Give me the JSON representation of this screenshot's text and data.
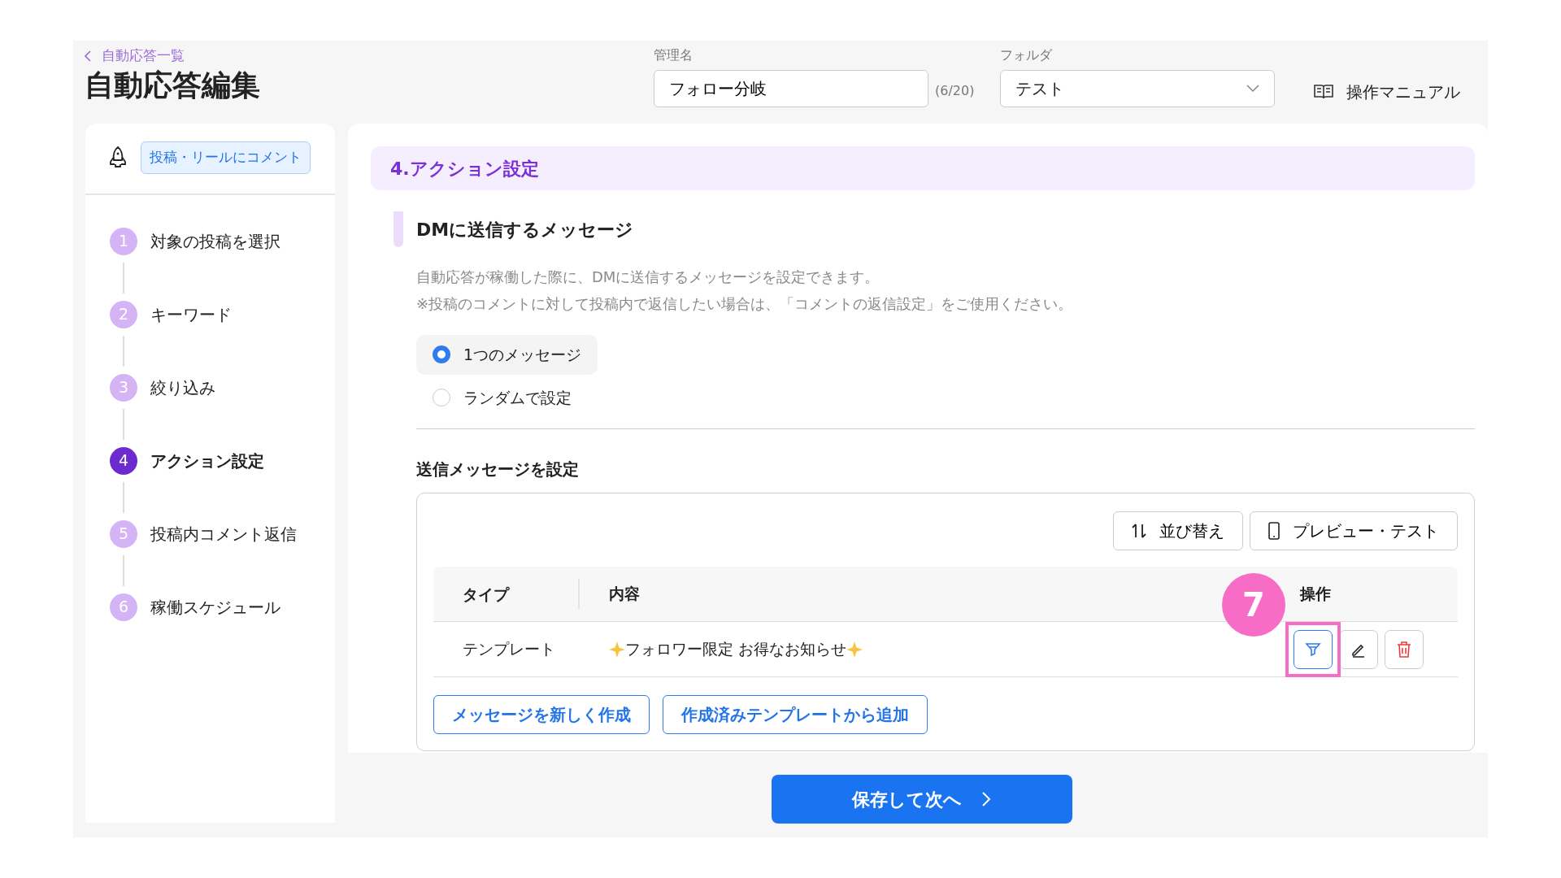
{
  "breadcrumb": "自動応答一覧",
  "title": "自動応答編集",
  "name_field": {
    "label": "管理名",
    "value": "フォロー分岐",
    "counter": "(6/20)"
  },
  "folder_field": {
    "label": "フォルダ",
    "value": "テスト"
  },
  "manual_link": "操作マニュアル",
  "trigger_tag": "投稿・リールにコメント",
  "steps": [
    {
      "number": "1",
      "label": "対象の投稿を選択",
      "selected": false
    },
    {
      "number": "2",
      "label": "キーワード",
      "selected": false
    },
    {
      "number": "3",
      "label": "絞り込み",
      "selected": false
    },
    {
      "number": "4",
      "label": "アクション設定",
      "selected": true
    },
    {
      "number": "5",
      "label": "投稿内コメント返信",
      "selected": false
    },
    {
      "number": "6",
      "label": "稼働スケジュール",
      "selected": false
    }
  ],
  "section_title": "4.アクション設定",
  "subtitle": "DMに送信するメッセージ",
  "description": [
    "自動応答が稼働した際に、DMに送信するメッセージを設定できます。",
    "※投稿のコメントに対して投稿内で返信したい場合は、「コメントの返信設定」をご使用ください。"
  ],
  "options": [
    {
      "label": "1つのメッセージ",
      "selected": true
    },
    {
      "label": "ランダムで設定",
      "selected": false
    }
  ],
  "messages_title": "送信メッセージを設定",
  "toolbar": [
    {
      "kind": "sort",
      "label": "並び替え"
    },
    {
      "kind": "preview",
      "label": "プレビュー・テスト"
    }
  ],
  "table": {
    "columns": [
      "タイプ",
      "内容",
      "操作"
    ],
    "rows": [
      {
        "type": "テンプレート",
        "content": "フォロワー限定 お得なお知らせ"
      }
    ]
  },
  "add_buttons": [
    "メッセージを新しく作成",
    "作成済みテンプレートから追加"
  ],
  "callout": "7",
  "save_button": "保存して次へ"
}
